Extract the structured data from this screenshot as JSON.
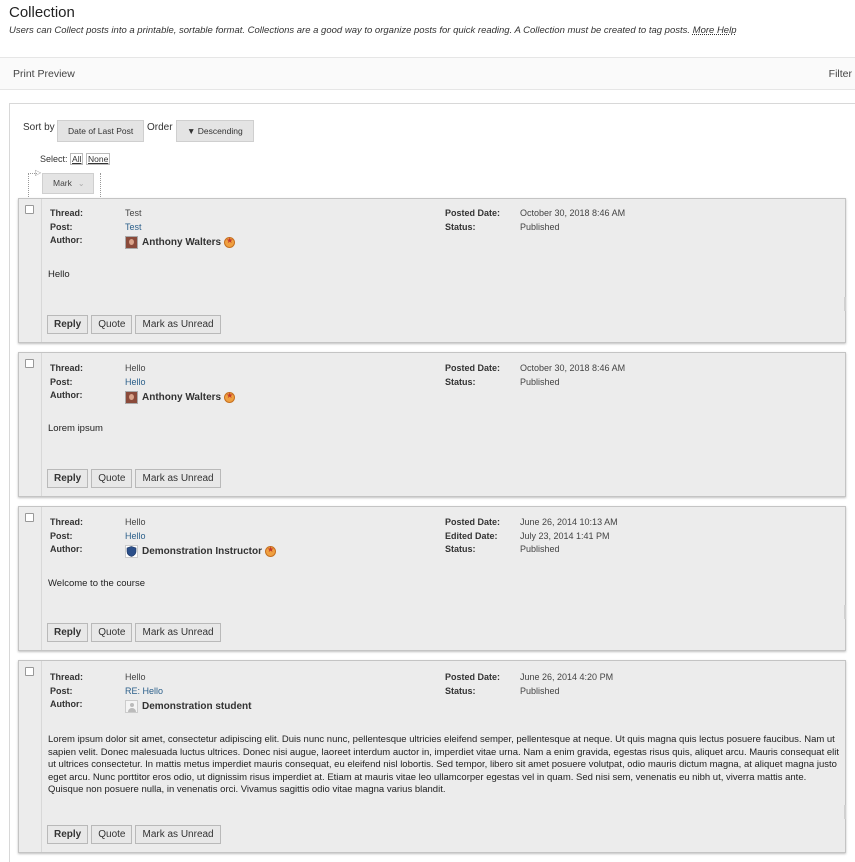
{
  "header": {
    "title": "Collection",
    "description": "Users can Collect posts into a printable, sortable format. Collections are a good way to organize posts for quick reading. A Collection must be created to tag posts.",
    "help_link": "More Help"
  },
  "toolbar": {
    "print_preview": "Print Preview",
    "filter": "Filter"
  },
  "sort": {
    "sort_by_label": "Sort by",
    "sort_by_value": "Date of Last Post",
    "order_label": "Order",
    "order_value": "▼ Descending"
  },
  "select": {
    "label": "Select:",
    "all": "All",
    "none": "None"
  },
  "mark": {
    "label": "Mark"
  },
  "labels": {
    "thread": "Thread:",
    "post": "Post:",
    "author": "Author:",
    "posted_date": "Posted Date:",
    "edited_date": "Edited Date:",
    "status": "Status:"
  },
  "actions": {
    "reply": "Reply",
    "quote": "Quote",
    "mark_unread": "Mark as Unread"
  },
  "posts": [
    {
      "thread": "Test",
      "post": "Test",
      "author": "Anthony Walters",
      "posted_date": "October 30, 2018 8:46 AM",
      "status": "Published",
      "body": "Hello"
    },
    {
      "thread": "Hello",
      "post": "Hello",
      "author": "Anthony Walters",
      "posted_date": "October 30, 2018 8:46 AM",
      "status": "Published",
      "body": "Lorem ipsum"
    },
    {
      "thread": "Hello",
      "post": "Hello",
      "author": "Demonstration Instructor",
      "posted_date": "June 26, 2014 10:13 AM",
      "edited_date": "July 23, 2014 1:41 PM",
      "status": "Published",
      "body": "Welcome to the course"
    },
    {
      "thread": "Hello",
      "post": "RE: Hello",
      "author": "Demonstration student",
      "posted_date": "June 26, 2014 4:20 PM",
      "status": "Published",
      "body": "Lorem ipsum dolor sit amet, consectetur adipiscing elit. Duis nunc nunc, pellentesque ultricies eleifend semper, pellentesque at neque. Ut quis magna quis lectus posuere faucibus. Nam ut sapien velit. Donec malesuada luctus ultrices. Donec nisi augue, laoreet interdum auctor in, imperdiet vitae urna. Nam a enim gravida, egestas risus quis, aliquet arcu. Mauris consequat elit ut ultrices consectetur. In mattis metus imperdiet mauris consequat, eu eleifend nisl lobortis. Sed tempor, libero sit amet posuere volutpat, odio mauris dictum magna, at aliquet magna justo eget arcu. Nunc porttitor eros odio, ut dignissim risus imperdiet at. Etiam at mauris vitae leo ullamcorper egestas vel in quam. Sed nisi sem, venenatis eu nibh ut, viverra mattis ante. Quisque non posuere nulla, in venenatis orci. Vivamus sagittis odio vitae magna varius blandit."
    }
  ]
}
